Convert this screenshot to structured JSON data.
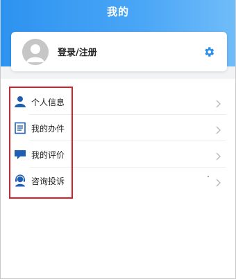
{
  "header": {
    "title": "我的"
  },
  "profile": {
    "login_label": "登录/注册",
    "avatar_icon": "default-user-avatar",
    "settings_icon": "gear-icon"
  },
  "menu": {
    "items": [
      {
        "label": "个人信息",
        "icon": "person-icon"
      },
      {
        "label": "我的办件",
        "icon": "document-list-icon"
      },
      {
        "label": "我的评价",
        "icon": "comment-icon"
      },
      {
        "label": "咨询投诉",
        "icon": "customer-service-icon"
      }
    ]
  },
  "colors": {
    "header_blue": "#2d93f0",
    "icon_blue": "#1e5fb3",
    "highlight_red": "#d9202a"
  }
}
